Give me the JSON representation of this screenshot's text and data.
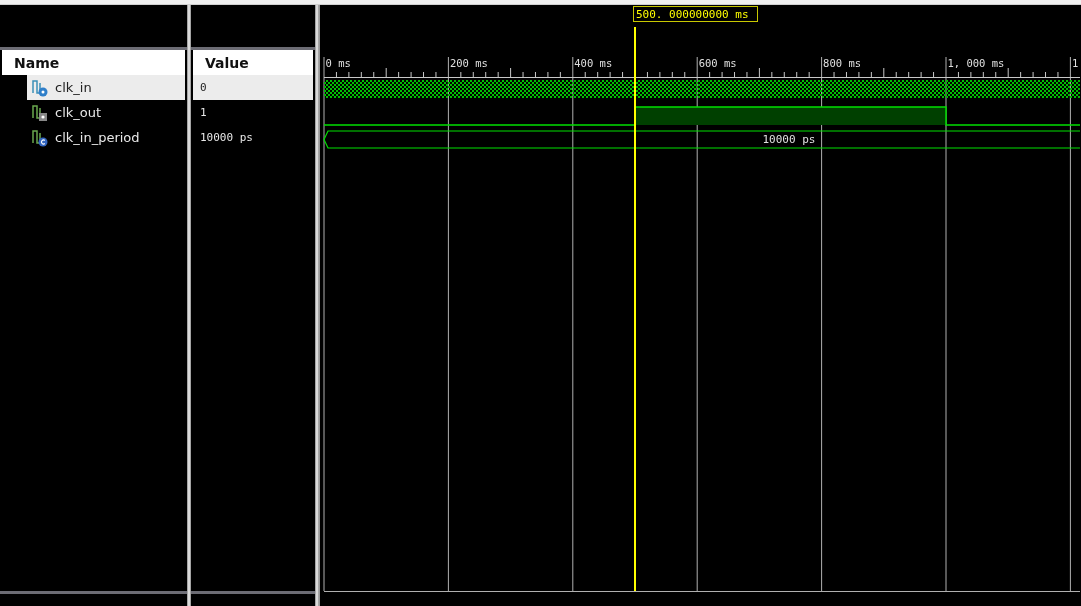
{
  "columns": {
    "name": "Name",
    "value": "Value"
  },
  "signals": [
    {
      "name": "clk_in",
      "value": "0",
      "kind": "input",
      "selected": true,
      "wave": {
        "kind": "clock"
      }
    },
    {
      "name": "clk_out",
      "value": "1",
      "kind": "output",
      "selected": false,
      "wave": {
        "kind": "pulse"
      }
    },
    {
      "name": "clk_in_period",
      "value": "10000 ps",
      "kind": "constant",
      "selected": false,
      "wave": {
        "kind": "bus",
        "label": "10000 ps"
      }
    }
  ],
  "timeline": {
    "ticks": [
      "0 ms",
      "200 ms",
      "400 ms",
      "600 ms",
      "800 ms",
      "1, 000 ms",
      "1"
    ],
    "cursor": "500. 000000000 ms"
  }
}
